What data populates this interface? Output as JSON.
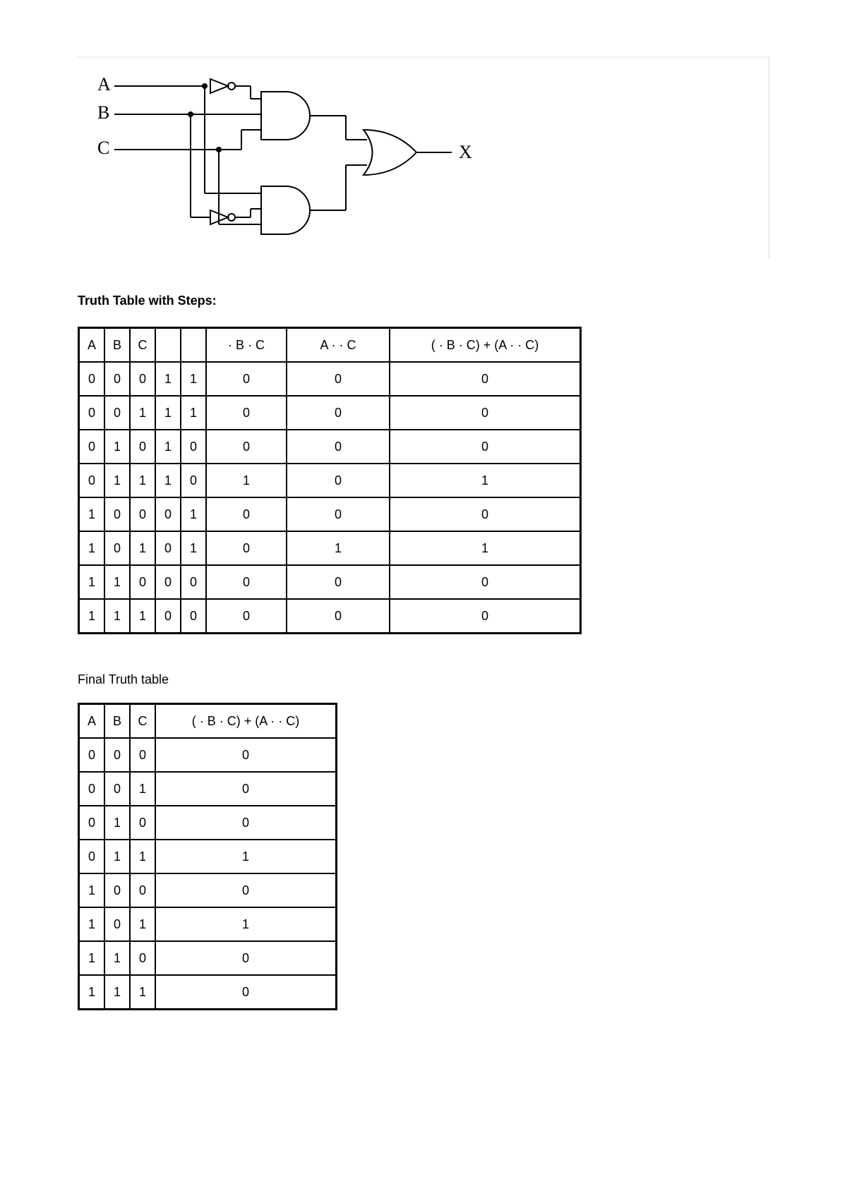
{
  "circuit": {
    "inputs": [
      "A",
      "B",
      "C"
    ],
    "output": "X"
  },
  "section1_title": "Truth Table with Steps:",
  "table1": {
    "headers": [
      "A",
      "B",
      "C",
      "",
      "",
      "· B · C",
      "A ·  · C",
      "( · B · C) + (A ·  · C)"
    ],
    "rows": [
      [
        "0",
        "0",
        "0",
        "1",
        "1",
        "0",
        "0",
        "0"
      ],
      [
        "0",
        "0",
        "1",
        "1",
        "1",
        "0",
        "0",
        "0"
      ],
      [
        "0",
        "1",
        "0",
        "1",
        "0",
        "0",
        "0",
        "0"
      ],
      [
        "0",
        "1",
        "1",
        "1",
        "0",
        "1",
        "0",
        "1"
      ],
      [
        "1",
        "0",
        "0",
        "0",
        "1",
        "0",
        "0",
        "0"
      ],
      [
        "1",
        "0",
        "1",
        "0",
        "1",
        "0",
        "1",
        "1"
      ],
      [
        "1",
        "1",
        "0",
        "0",
        "0",
        "0",
        "0",
        "0"
      ],
      [
        "1",
        "1",
        "1",
        "0",
        "0",
        "0",
        "0",
        "0"
      ]
    ]
  },
  "section2_title": "Final Truth table",
  "table2": {
    "headers": [
      "A",
      "B",
      "C",
      "( · B · C) + (A ·  · C)"
    ],
    "rows": [
      [
        "0",
        "0",
        "0",
        "0"
      ],
      [
        "0",
        "0",
        "1",
        "0"
      ],
      [
        "0",
        "1",
        "0",
        "0"
      ],
      [
        "0",
        "1",
        "1",
        "1"
      ],
      [
        "1",
        "0",
        "0",
        "0"
      ],
      [
        "1",
        "0",
        "1",
        "1"
      ],
      [
        "1",
        "1",
        "0",
        "0"
      ],
      [
        "1",
        "1",
        "1",
        "0"
      ]
    ]
  }
}
